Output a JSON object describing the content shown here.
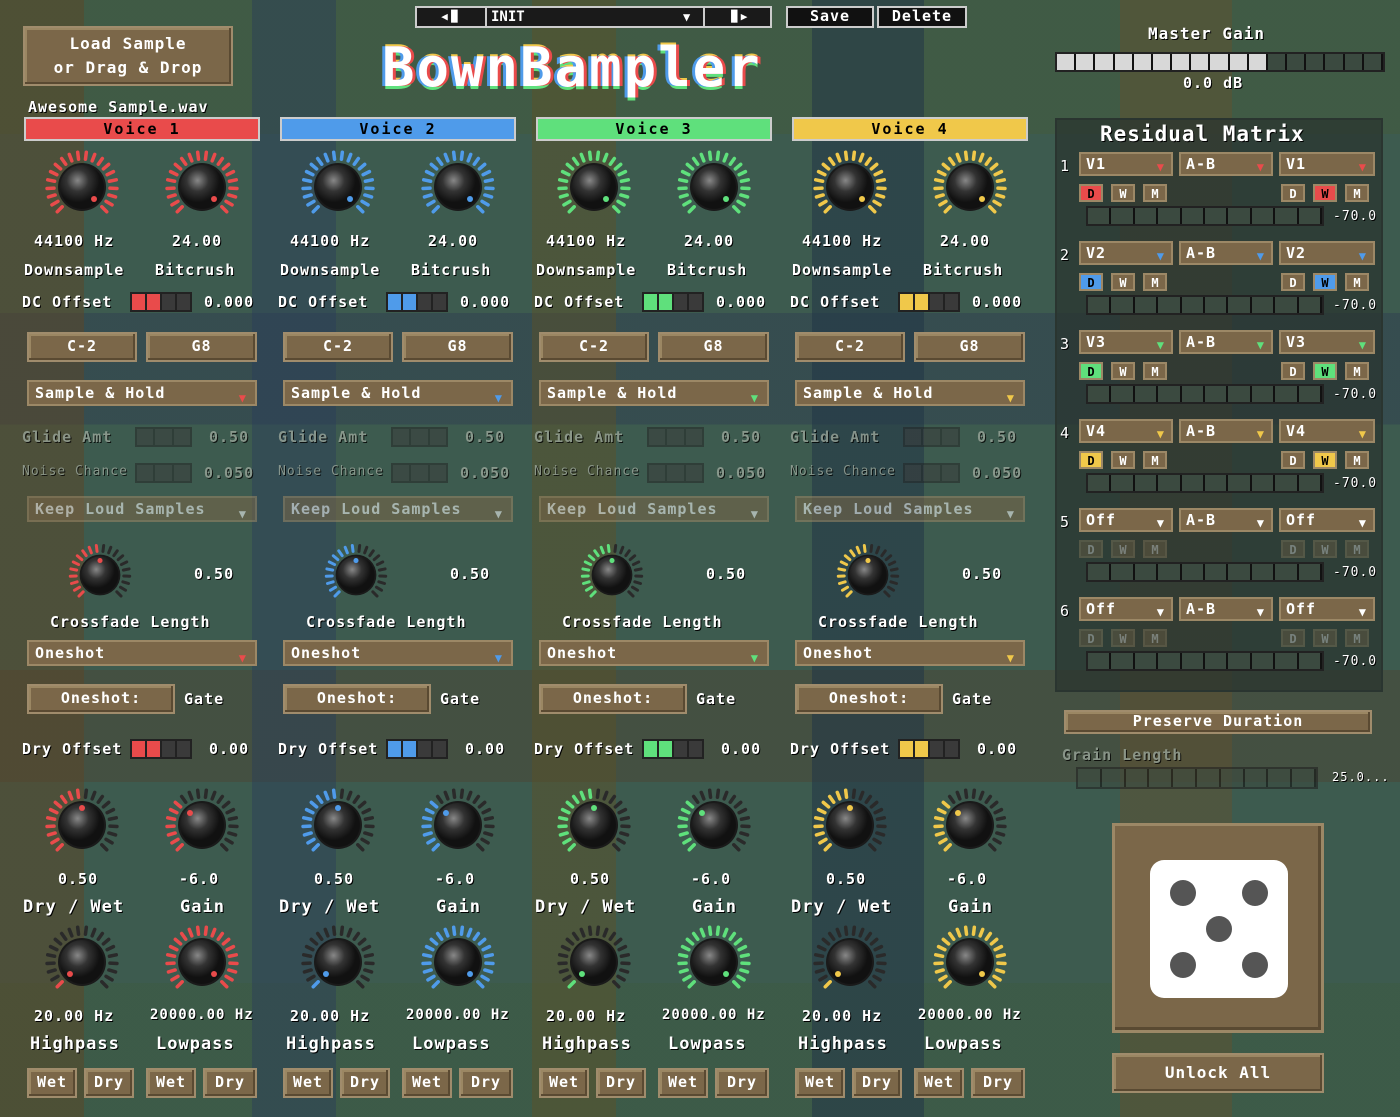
{
  "header": {
    "load_line1": "Load Sample",
    "load_line2": "or Drag & Drop",
    "sample_name": "Awesome Sample.wav",
    "preset_name": "INIT",
    "save_label": "Save",
    "delete_label": "Delete",
    "title": "BownBampler",
    "master_gain_label": "Master Gain",
    "master_gain_value": "0.0 dB",
    "master_gain_level": 0.64
  },
  "colors": {
    "v1": "#e94b4b",
    "v2": "#4f9bea",
    "v3": "#5fe07c",
    "v4": "#f0c84a"
  },
  "voices": [
    {
      "name": "Voice 1",
      "downsample_value": "44100 Hz",
      "downsample_label": "Downsample",
      "bitcrush_value": "24.00",
      "bitcrush_label": "Bitcrush",
      "dc_offset_label": "DC Offset",
      "dc_offset_value": "0.000",
      "note_low": "C-2",
      "note_high": "G8",
      "interp": "Sample & Hold",
      "glide_label": "Glide Amt",
      "glide_value": "0.50",
      "noise_label": "Noise Chance",
      "noise_value": "0.050",
      "keep_label": "Keep Loud Samples",
      "crossfade_value": "0.50",
      "crossfade_label": "Crossfade Length",
      "mode": "Oneshot",
      "oneshot_btn": "Oneshot:",
      "oneshot_val": "Gate",
      "dry_offset_label": "Dry Offset",
      "dry_offset_value": "0.00",
      "drywet_value": "0.50",
      "drywet_label": "Dry / Wet",
      "gain_value": "-6.0",
      "gain_label": "Gain",
      "hp_value": "20.00 Hz",
      "hp_label": "Highpass",
      "lp_value": "20000.00 Hz",
      "lp_label": "Lowpass",
      "wet": "Wet",
      "dry": "Dry"
    },
    {
      "name": "Voice 2",
      "downsample_value": "44100 Hz",
      "downsample_label": "Downsample",
      "bitcrush_value": "24.00",
      "bitcrush_label": "Bitcrush",
      "dc_offset_label": "DC Offset",
      "dc_offset_value": "0.000",
      "note_low": "C-2",
      "note_high": "G8",
      "interp": "Sample & Hold",
      "glide_label": "Glide Amt",
      "glide_value": "0.50",
      "noise_label": "Noise Chance",
      "noise_value": "0.050",
      "keep_label": "Keep Loud Samples",
      "crossfade_value": "0.50",
      "crossfade_label": "Crossfade Length",
      "mode": "Oneshot",
      "oneshot_btn": "Oneshot:",
      "oneshot_val": "Gate",
      "dry_offset_label": "Dry Offset",
      "dry_offset_value": "0.00",
      "drywet_value": "0.50",
      "drywet_label": "Dry / Wet",
      "gain_value": "-6.0",
      "gain_label": "Gain",
      "hp_value": "20.00 Hz",
      "hp_label": "Highpass",
      "lp_value": "20000.00 Hz",
      "lp_label": "Lowpass",
      "wet": "Wet",
      "dry": "Dry"
    },
    {
      "name": "Voice 3",
      "downsample_value": "44100 Hz",
      "downsample_label": "Downsample",
      "bitcrush_value": "24.00",
      "bitcrush_label": "Bitcrush",
      "dc_offset_label": "DC Offset",
      "dc_offset_value": "0.000",
      "note_low": "C-2",
      "note_high": "G8",
      "interp": "Sample & Hold",
      "glide_label": "Glide Amt",
      "glide_value": "0.50",
      "noise_label": "Noise Chance",
      "noise_value": "0.050",
      "keep_label": "Keep Loud Samples",
      "crossfade_value": "0.50",
      "crossfade_label": "Crossfade Length",
      "mode": "Oneshot",
      "oneshot_btn": "Oneshot:",
      "oneshot_val": "Gate",
      "dry_offset_label": "Dry Offset",
      "dry_offset_value": "0.00",
      "drywet_value": "0.50",
      "drywet_label": "Dry / Wet",
      "gain_value": "-6.0",
      "gain_label": "Gain",
      "hp_value": "20.00 Hz",
      "hp_label": "Highpass",
      "lp_value": "20000.00 Hz",
      "lp_label": "Lowpass",
      "wet": "Wet",
      "dry": "Dry"
    },
    {
      "name": "Voice 4",
      "downsample_value": "44100 Hz",
      "downsample_label": "Downsample",
      "bitcrush_value": "24.00",
      "bitcrush_label": "Bitcrush",
      "dc_offset_label": "DC Offset",
      "dc_offset_value": "0.000",
      "note_low": "C-2",
      "note_high": "G8",
      "interp": "Sample & Hold",
      "glide_label": "Glide Amt",
      "glide_value": "0.50",
      "noise_label": "Noise Chance",
      "noise_value": "0.050",
      "keep_label": "Keep Loud Samples",
      "crossfade_value": "0.50",
      "crossfade_label": "Crossfade Length",
      "mode": "Oneshot",
      "oneshot_btn": "Oneshot:",
      "oneshot_val": "Gate",
      "dry_offset_label": "Dry Offset",
      "dry_offset_value": "0.00",
      "drywet_value": "0.50",
      "drywet_label": "Dry / Wet",
      "gain_value": "-6.0",
      "gain_label": "Gain",
      "hp_value": "20.00 Hz",
      "hp_label": "Highpass",
      "lp_value": "20000.00 Hz",
      "lp_label": "Lowpass",
      "wet": "Wet",
      "dry": "Dry"
    }
  ],
  "matrix": {
    "title": "Residual Matrix",
    "rows": [
      {
        "num": "1",
        "a": "V1",
        "op": "A-B",
        "b": "V1",
        "value": "-70.0",
        "t": [
          "D",
          "W",
          "M"
        ],
        "t2": [
          "D",
          "W",
          "M"
        ],
        "ca": "v1",
        "cb": "v1",
        "active": true,
        "onA": 0,
        "onB": 1
      },
      {
        "num": "2",
        "a": "V2",
        "op": "A-B",
        "b": "V2",
        "value": "-70.0",
        "t": [
          "D",
          "W",
          "M"
        ],
        "t2": [
          "D",
          "W",
          "M"
        ],
        "ca": "v2",
        "cb": "v2",
        "active": true,
        "onA": 0,
        "onB": 1
      },
      {
        "num": "3",
        "a": "V3",
        "op": "A-B",
        "b": "V3",
        "value": "-70.0",
        "t": [
          "D",
          "W",
          "M"
        ],
        "t2": [
          "D",
          "W",
          "M"
        ],
        "ca": "v3",
        "cb": "v3",
        "active": true,
        "onA": 0,
        "onB": 1
      },
      {
        "num": "4",
        "a": "V4",
        "op": "A-B",
        "b": "V4",
        "value": "-70.0",
        "t": [
          "D",
          "W",
          "M"
        ],
        "t2": [
          "D",
          "W",
          "M"
        ],
        "ca": "v4",
        "cb": "v4",
        "active": true,
        "onA": 0,
        "onB": 1
      },
      {
        "num": "5",
        "a": "Off",
        "op": "A-B",
        "b": "Off",
        "value": "-70.0",
        "t": [
          "D",
          "W",
          "M"
        ],
        "t2": [
          "D",
          "W",
          "M"
        ],
        "ca": "",
        "cb": "",
        "active": false,
        "onA": -1,
        "onB": -1
      },
      {
        "num": "6",
        "a": "Off",
        "op": "A-B",
        "b": "Off",
        "value": "-70.0",
        "t": [
          "D",
          "W",
          "M"
        ],
        "t2": [
          "D",
          "W",
          "M"
        ],
        "ca": "",
        "cb": "",
        "active": false,
        "onA": -1,
        "onB": -1
      }
    ]
  },
  "right": {
    "preserve_label": "Preserve Duration",
    "grain_label": "Grain Length",
    "grain_value": "25.0...",
    "unlock_label": "Unlock All"
  }
}
